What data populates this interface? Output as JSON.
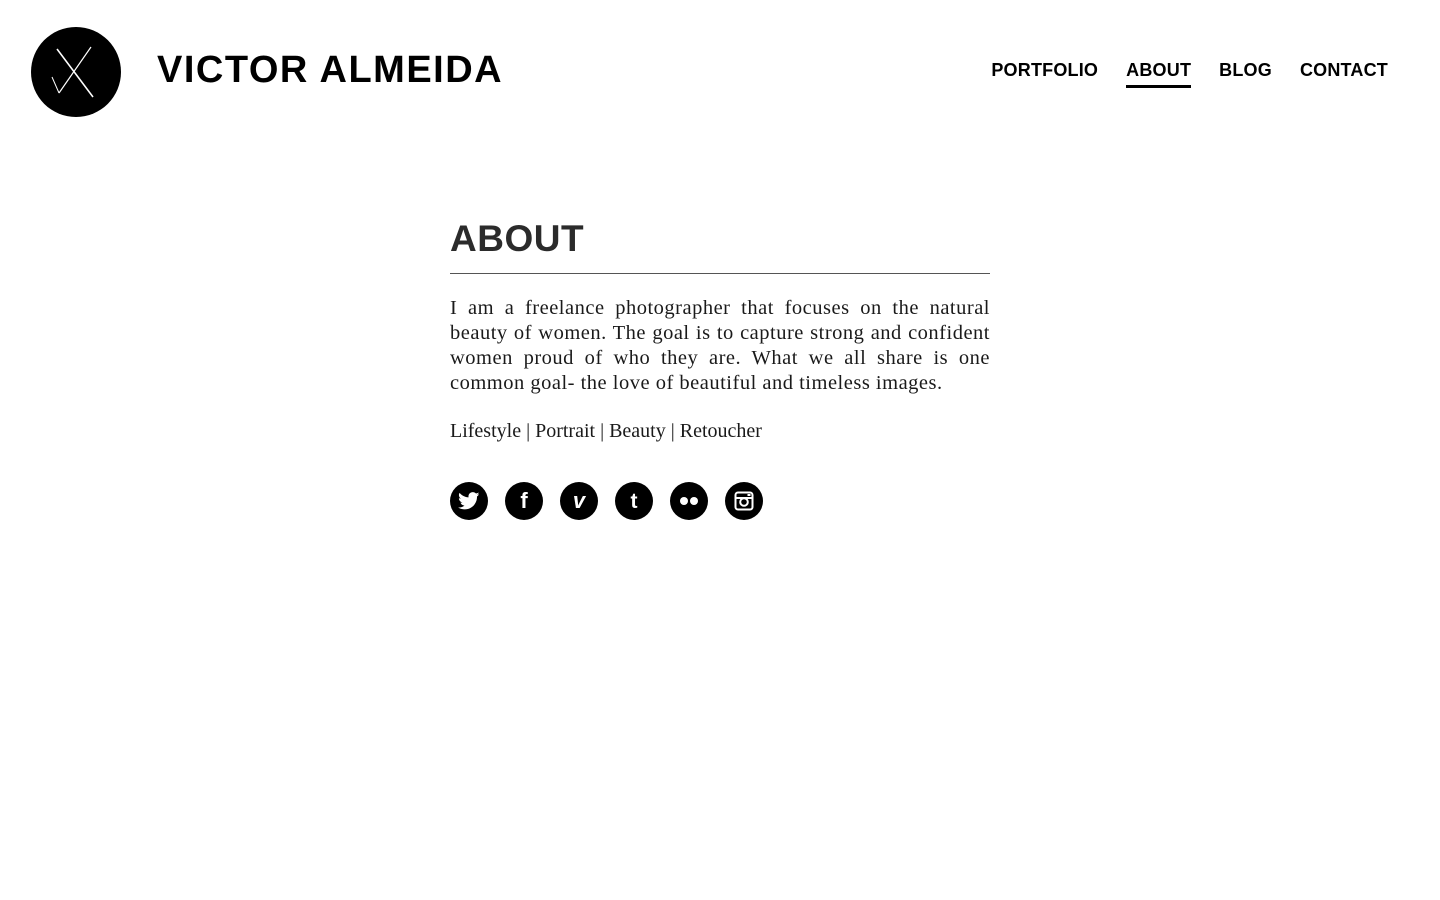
{
  "header": {
    "logo_icon": "x-monogram-icon",
    "site_title": "VICTOR ALMEIDA",
    "nav": [
      {
        "label": "PORTFOLIO",
        "active": false
      },
      {
        "label": "ABOUT",
        "active": true
      },
      {
        "label": "BLOG",
        "active": false
      },
      {
        "label": "CONTACT",
        "active": false
      }
    ]
  },
  "main": {
    "heading": "ABOUT",
    "bio": "I am a freelance photographer that focuses on the natural beauty of women. The goal is to capture strong and confident women proud of who they are. What we all share is one common goal- the love of beautiful and timeless images.",
    "tags": "Lifestyle | Portrait | Beauty | Retoucher",
    "socials": [
      {
        "icon": "twitter-icon"
      },
      {
        "icon": "facebook-icon",
        "glyph": "f"
      },
      {
        "icon": "vimeo-icon",
        "glyph": "v"
      },
      {
        "icon": "tumblr-icon",
        "glyph": "t"
      },
      {
        "icon": "flickr-icon"
      },
      {
        "icon": "instagram-icon"
      }
    ]
  },
  "colors": {
    "background": "#ffffff",
    "text": "#111111",
    "accent": "#000000"
  }
}
